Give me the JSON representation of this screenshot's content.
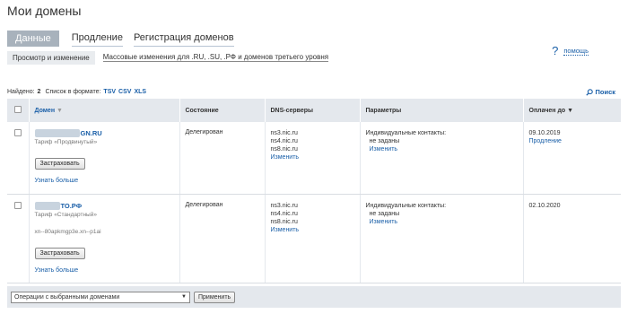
{
  "page": {
    "title": "Мои домены"
  },
  "tabs": [
    {
      "label": "Данные",
      "active": true
    },
    {
      "label": "Продление",
      "active": false
    },
    {
      "label": "Регистрация доменов",
      "active": false
    }
  ],
  "subtabs": [
    {
      "label": "Просмотр и изменение",
      "active": true
    },
    {
      "label": "Массовые изменения для .RU, .SU, .РФ и доменов третьего уровня",
      "active": false
    }
  ],
  "help": {
    "icon": "question-icon",
    "label": "помощь"
  },
  "found": {
    "prefix": "Найдено:",
    "count": "2",
    "format_label": "Список в формате:",
    "formats": [
      "TSV",
      "CSV",
      "XLS"
    ]
  },
  "search": {
    "icon": "magnifier-icon",
    "label": "Поиск"
  },
  "table": {
    "columns": {
      "domain": "Домен",
      "status": "Состояние",
      "dns": "DNS-серверы",
      "params": "Параметры",
      "paid_until": "Оплачен до"
    },
    "rows": [
      {
        "domain_suffix": "GN.RU",
        "tariff": "Тариф «Продвинутый»",
        "punycode": "",
        "insure_button": "Застраховать",
        "learn_more": "Узнать больше",
        "status": "Делегирован",
        "dns": [
          "ns3.nic.ru",
          "ns4.nic.ru",
          "ns8.nic.ru"
        ],
        "dns_edit": "Изменить",
        "params_label": "Индивидуальные контакты:",
        "params_value": "не заданы",
        "params_edit": "Изменить",
        "paid_until": "09.10.2019",
        "renew": "Продление"
      },
      {
        "domain_suffix": "ТО.РФ",
        "tariff": "Тариф «Стандартный»",
        "punycode": "xn--80apkmgp3e.xn--p1ai",
        "insure_button": "Застраховать",
        "learn_more": "Узнать больше",
        "status": "Делегирован",
        "dns": [
          "ns3.nic.ru",
          "ns4.nic.ru",
          "ns8.nic.ru"
        ],
        "dns_edit": "Изменить",
        "params_label": "Индивидуальные контакты:",
        "params_value": "не заданы",
        "params_edit": "Изменить",
        "paid_until": "02.10.2020",
        "renew": ""
      }
    ]
  },
  "bottom": {
    "select_value": "Операции с выбранными доменами",
    "apply": "Применить"
  }
}
